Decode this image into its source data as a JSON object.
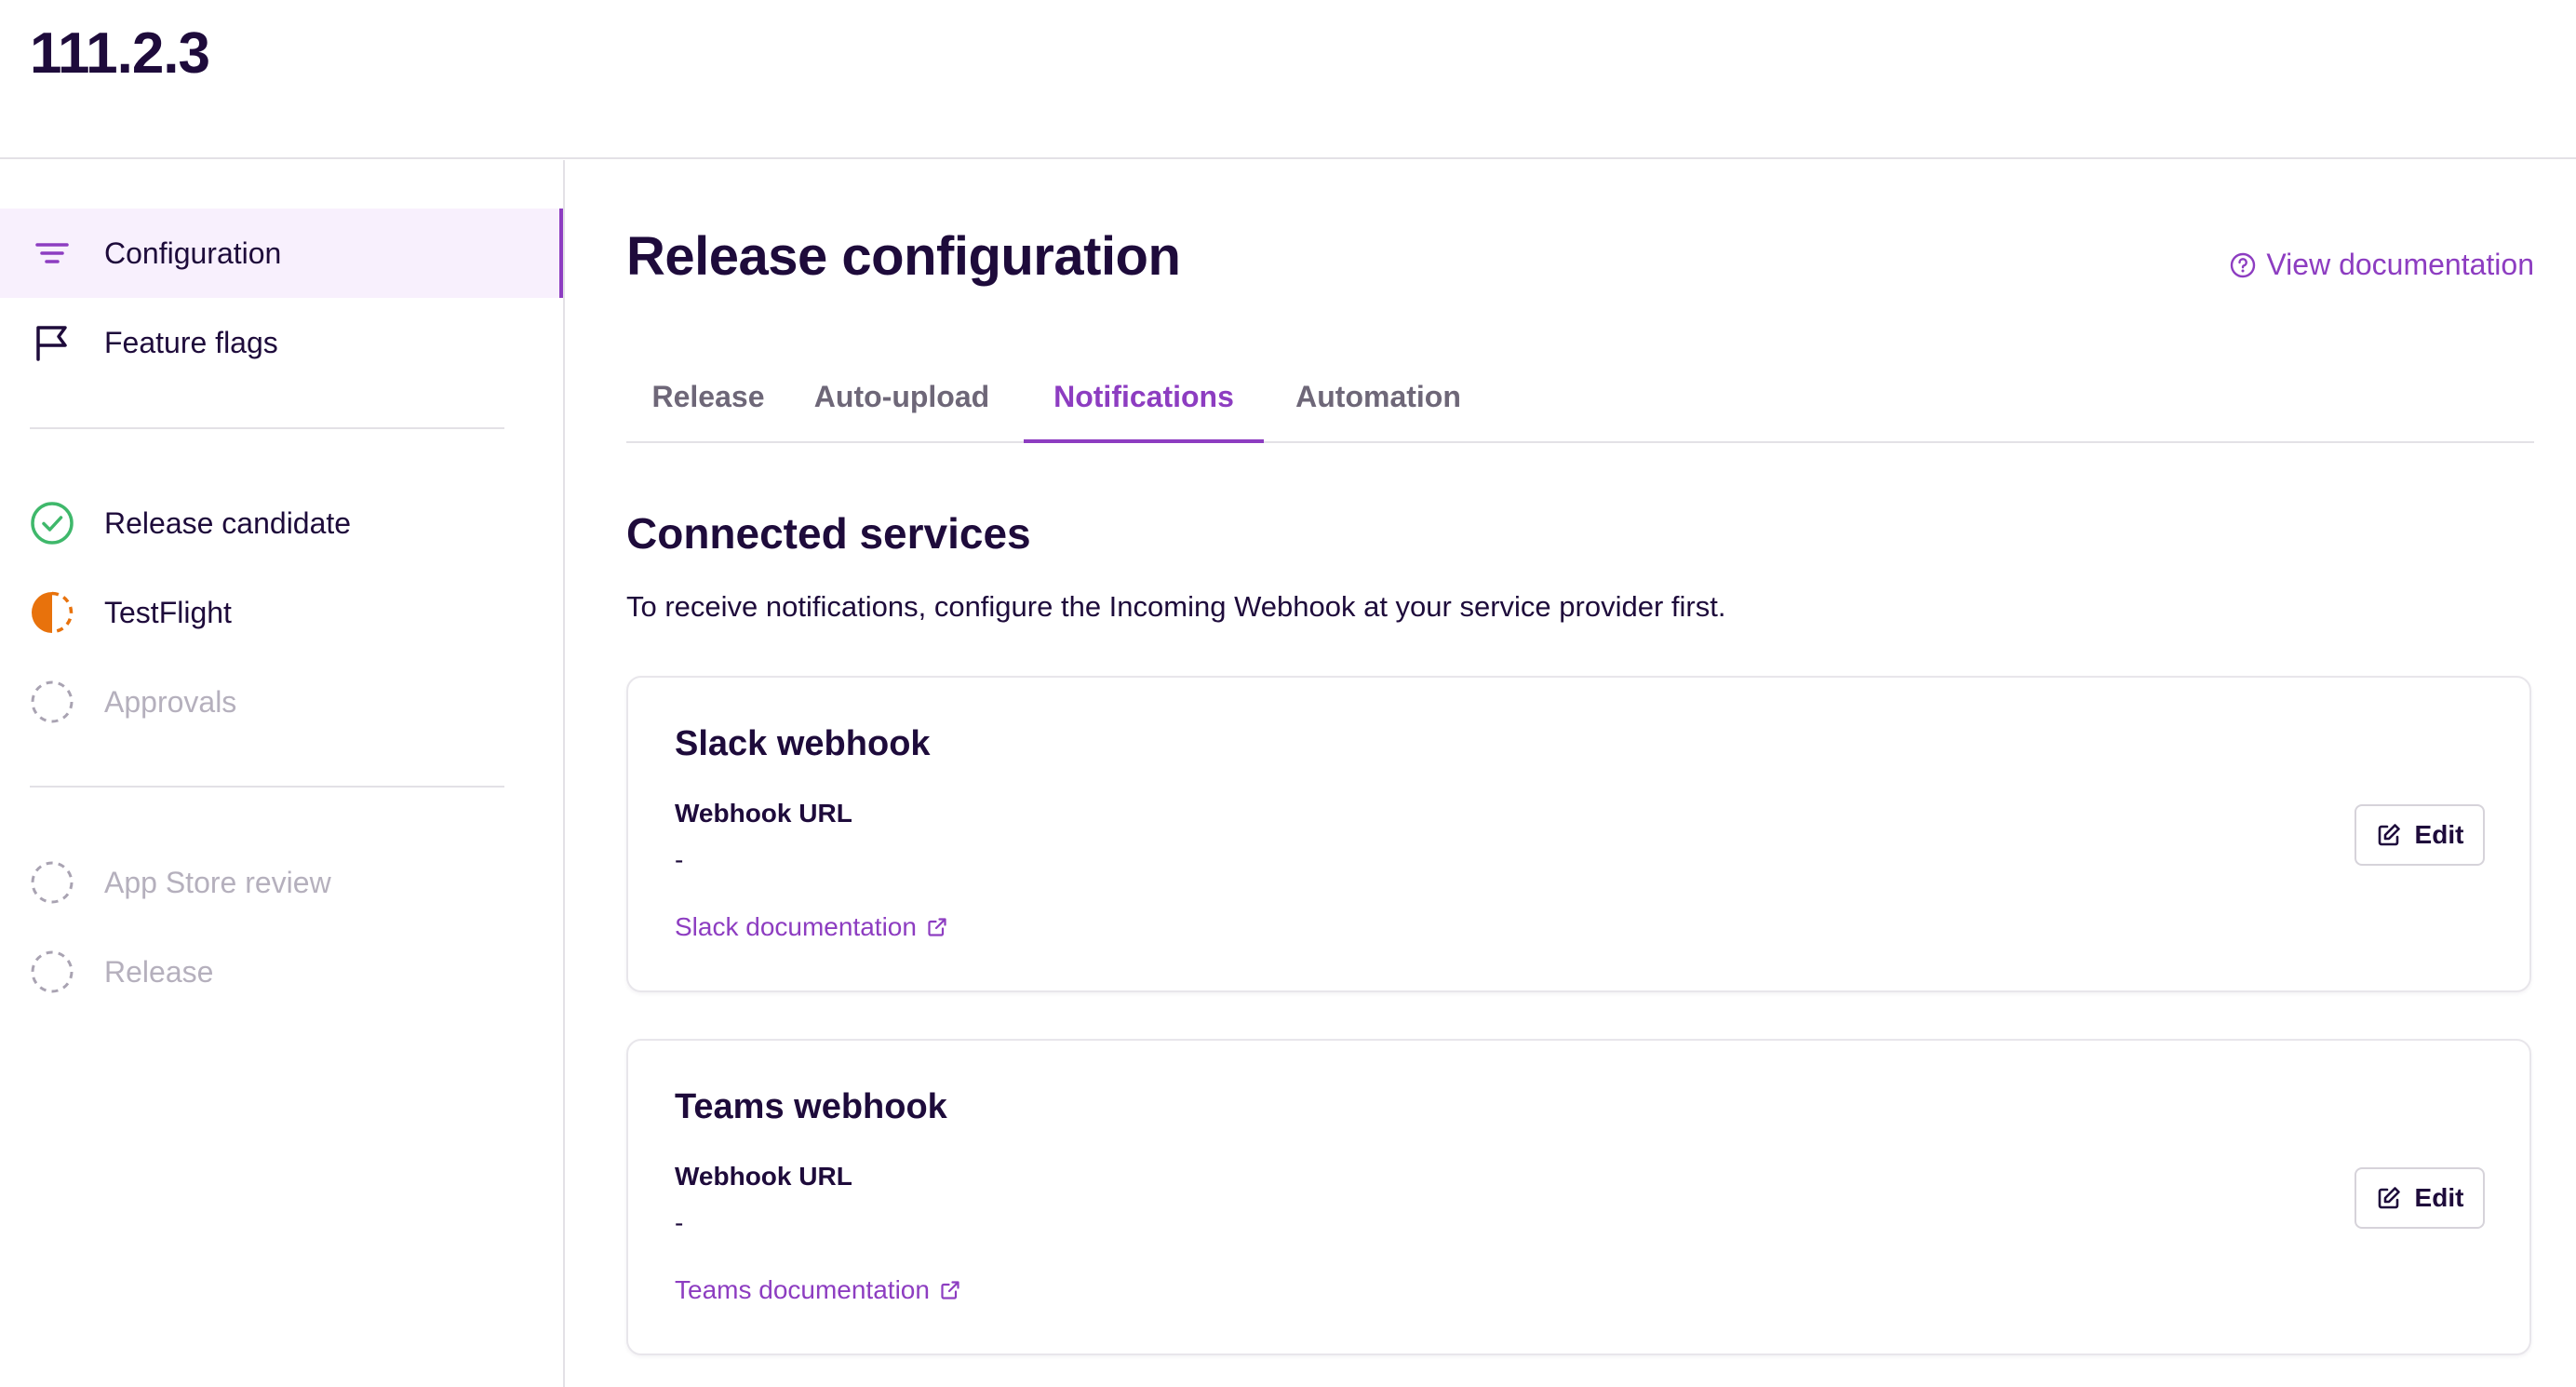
{
  "header": {
    "version": "111.2.3"
  },
  "sidebar": {
    "items": [
      {
        "label": "Configuration",
        "icon": "filter-lines-icon",
        "state": "active"
      },
      {
        "label": "Feature flags",
        "icon": "flag-icon",
        "state": "normal"
      },
      {
        "label": "Release candidate",
        "icon": "check-circle-icon",
        "state": "complete"
      },
      {
        "label": "TestFlight",
        "icon": "half-circle-progress-icon",
        "state": "in-progress"
      },
      {
        "label": "Approvals",
        "icon": "dashed-circle-icon",
        "state": "disabled"
      },
      {
        "label": "App Store review",
        "icon": "dashed-circle-icon",
        "state": "disabled"
      },
      {
        "label": "Release",
        "icon": "dashed-circle-icon",
        "state": "disabled"
      }
    ]
  },
  "main": {
    "title": "Release configuration",
    "view_documentation": "View documentation",
    "tabs": [
      {
        "label": "Release",
        "active": false
      },
      {
        "label": "Auto-upload",
        "active": false
      },
      {
        "label": "Notifications",
        "active": true
      },
      {
        "label": "Automation",
        "active": false
      }
    ],
    "section_title": "Connected services",
    "section_description": "To receive notifications, configure the Incoming Webhook at your service provider first.",
    "cards": [
      {
        "title": "Slack webhook",
        "field_label": "Webhook URL",
        "field_value": "-",
        "link_label": "Slack documentation",
        "edit_label": "Edit"
      },
      {
        "title": "Teams webhook",
        "field_label": "Webhook URL",
        "field_value": "-",
        "link_label": "Teams documentation",
        "edit_label": "Edit"
      }
    ]
  },
  "colors": {
    "accent": "#8d3dc1",
    "text": "#1e0b3b",
    "success": "#3fb86b",
    "warning": "#e8720c",
    "muted": "#b5b0bd"
  }
}
